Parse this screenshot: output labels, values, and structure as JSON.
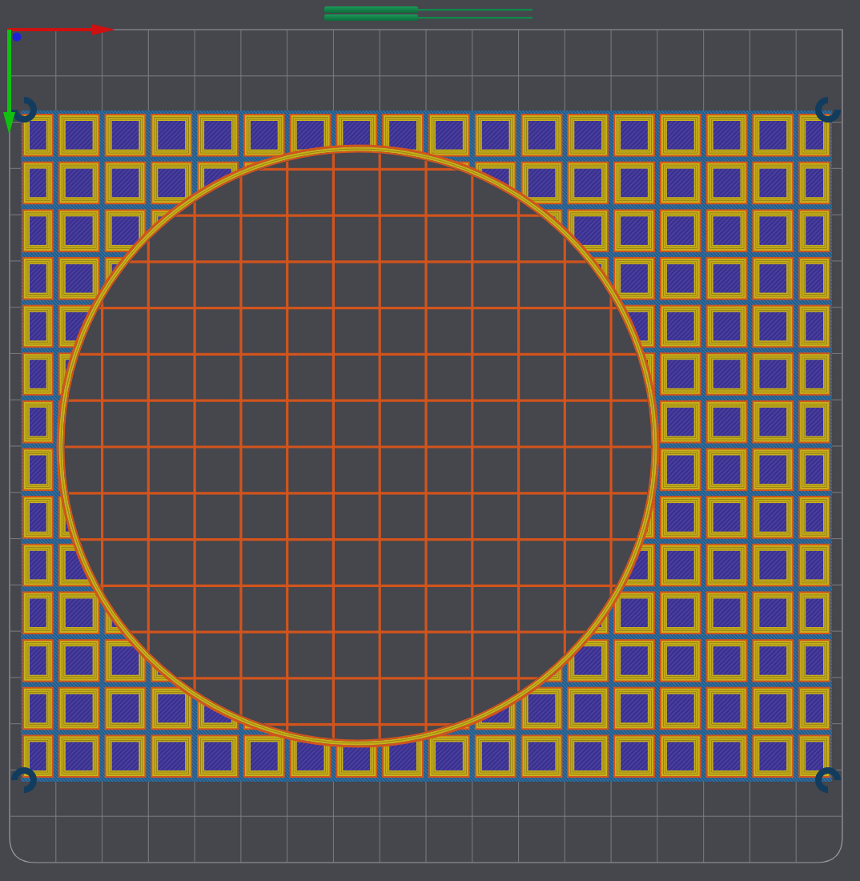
{
  "viewport": {
    "kind": "layer-preview"
  },
  "moves_slider": {
    "level": 0.45
  }
}
